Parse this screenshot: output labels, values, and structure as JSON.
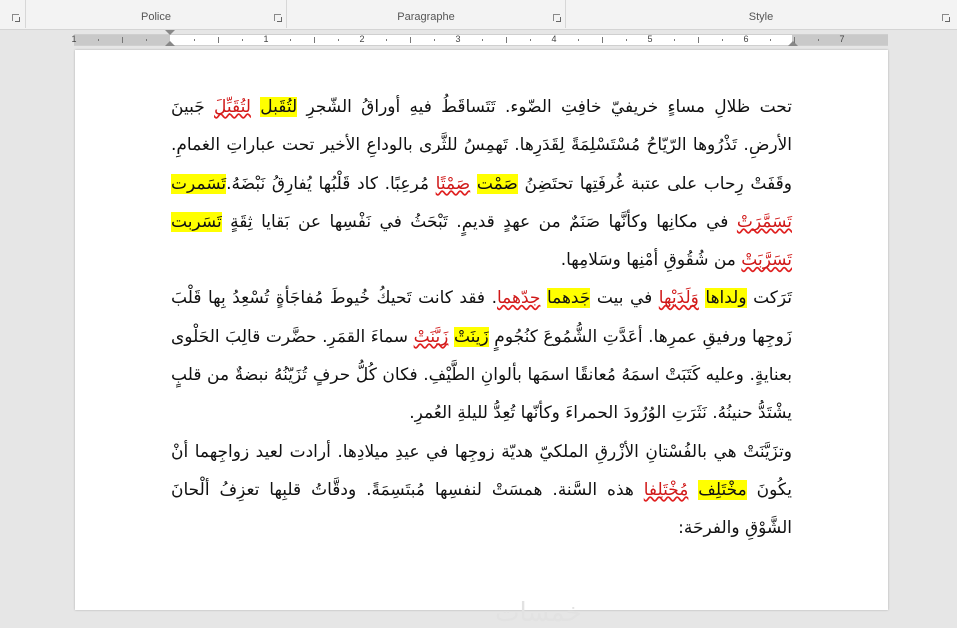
{
  "ribbon": {
    "groups": [
      {
        "label": "Police"
      },
      {
        "label": "Paragraphe"
      },
      {
        "label": "Style"
      }
    ]
  },
  "ruler": {
    "labels": [
      "1",
      "1",
      "2",
      "3",
      "4",
      "5",
      "6",
      "7"
    ]
  },
  "document": {
    "paragraphs": [
      [
        {
          "t": "تحت ظلالِ مساءٍ خريفيّ خافِتِ الضّوء. تَتَساقَطُ فيهِ أوراقُ الشّجرِ "
        },
        {
          "t": "لتُقَبل",
          "hl": true
        },
        {
          "t": " "
        },
        {
          "t": "لتُقَبِّلَ",
          "sp": true
        },
        {
          "t": " جَبينَ الأرضِ. تَذْرُوها الرّيّاحُ مُسْتَسْلِمَةً لِقَدَرِها. تَهمِسُ للثَّرى بالوداعِ الأخير تحت عباراتِ الغمامِ. وقَفَتْ رِحاب على عتبة غُرفَتِها تحتَضِنُ "
        },
        {
          "t": "صَمْت",
          "hl": true
        },
        {
          "t": " "
        },
        {
          "t": "صَمْتًا",
          "sp": true
        },
        {
          "t": " مُرعِبًا. كاد قَلْبُها يُفارِقُ نَبْضَهُ."
        },
        {
          "t": "تَسَمرت",
          "hl": true
        },
        {
          "t": " "
        },
        {
          "t": "تَسَمَّرَتْ",
          "sp": true
        },
        {
          "t": " في مكانِها وكأنَّها صَنَمٌ من عهدٍ قديمٍ. تَبْحَثُ في نَفْسِها عن بَقايا ثِقَةٍ "
        },
        {
          "t": "تَسَربت",
          "hl": true
        },
        {
          "t": " "
        },
        {
          "t": "تَسَرَّبَتْ",
          "sp": true
        },
        {
          "t": " من شُقُوقِ أمْنِها وسَلامِها."
        }
      ],
      [
        {
          "t": "تَرَكت "
        },
        {
          "t": "ولداها",
          "hl": true
        },
        {
          "t": " "
        },
        {
          "t": "وَلَدَيْها",
          "sp": true
        },
        {
          "t": " في بيت "
        },
        {
          "t": "جَدهما",
          "hl": true
        },
        {
          "t": " "
        },
        {
          "t": "جدّهما",
          "sp": true
        },
        {
          "t": ". فقد كانت تَحيكُ خُيوطَ مُفاجَأةٍ تُسْعِدُ بِها قَلْبَ زَوجِها ورفيقِ عمرِها. أعَدَّتِ الشُّمُوعَ كنُجُومٍ "
        },
        {
          "t": "زَينَتْ",
          "hl": true
        },
        {
          "t": " "
        },
        {
          "t": "زَيَّنَتْ",
          "sp": true
        },
        {
          "t": " سماءَ القمَرِ. حضَّرت قالِبَ الحَلْوى بعنايةٍ. وعليه كَتَبَتْ اسمَهُ مُعانقًا اسمَها بألوانِ الطَّيْفِ. فكان كُلُّ حرفٍ تُزَيّنُهُ نبضةٌ من قلبٍ يشْتَدُّ حنينُهُ. نَثَرَتِ الوُرُودَ الحمراءَ وكأنّها تُعِدُّ لليلةِ العُمرِ."
        }
      ],
      [
        {
          "t": "وتزَيَّنَتْ هي بالفُسْتانِ الأزْرقِ الملكيّ هديّة زوجِها في عيدِ ميلادِها. أرادت لعيد زواجِهما أنْ يكُونَ "
        },
        {
          "t": "مخْتَلِف",
          "hl": true
        },
        {
          "t": " "
        },
        {
          "t": "مُخْتَلِفا",
          "sp": true
        },
        {
          "t": " هذه السَّنة. همسَتْ لنفسِها مُبتَسِمَةً. ودقَّاتُ قلبِها تعزِفُ ألْحانَ الشَّوْقِ والفرحَة:"
        }
      ]
    ]
  },
  "watermark": "خمسات",
  "colors": {
    "highlight": "#ffff00",
    "spelling_error": "#d01818"
  }
}
